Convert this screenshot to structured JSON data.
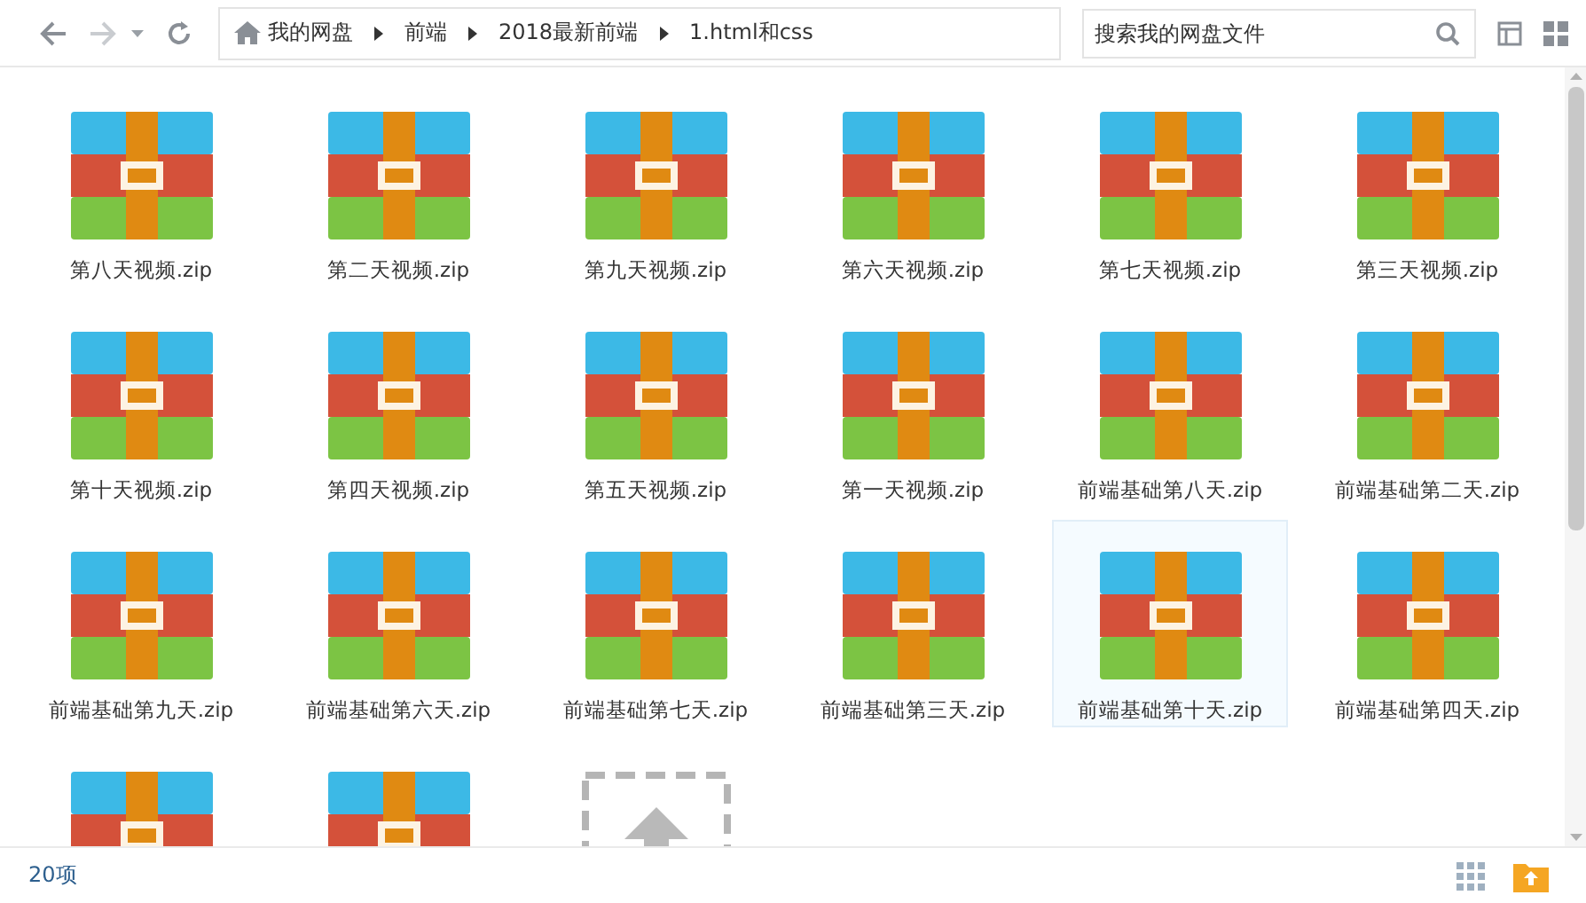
{
  "toolbar": {
    "breadcrumbs": [
      "我的网盘",
      "前端",
      "2018最新前端",
      "1.html和css"
    ],
    "search": {
      "placeholder": "搜索我的网盘文件"
    }
  },
  "files": [
    {
      "kind": "zip",
      "name": "第八天视频.zip",
      "hovered": false
    },
    {
      "kind": "zip",
      "name": "第二天视频.zip",
      "hovered": false
    },
    {
      "kind": "zip",
      "name": "第九天视频.zip",
      "hovered": false
    },
    {
      "kind": "zip",
      "name": "第六天视频.zip",
      "hovered": false
    },
    {
      "kind": "zip",
      "name": "第七天视频.zip",
      "hovered": false
    },
    {
      "kind": "zip",
      "name": "第三天视频.zip",
      "hovered": false
    },
    {
      "kind": "zip",
      "name": "第十天视频.zip",
      "hovered": false
    },
    {
      "kind": "zip",
      "name": "第四天视频.zip",
      "hovered": false
    },
    {
      "kind": "zip",
      "name": "第五天视频.zip",
      "hovered": false
    },
    {
      "kind": "zip",
      "name": "第一天视频.zip",
      "hovered": false
    },
    {
      "kind": "zip",
      "name": "前端基础第八天.zip",
      "hovered": false
    },
    {
      "kind": "zip",
      "name": "前端基础第二天.zip",
      "hovered": false
    },
    {
      "kind": "zip",
      "name": "前端基础第九天.zip",
      "hovered": false
    },
    {
      "kind": "zip",
      "name": "前端基础第六天.zip",
      "hovered": false
    },
    {
      "kind": "zip",
      "name": "前端基础第七天.zip",
      "hovered": false
    },
    {
      "kind": "zip",
      "name": "前端基础第三天.zip",
      "hovered": false
    },
    {
      "kind": "zip",
      "name": "前端基础第十天.zip",
      "hovered": true
    },
    {
      "kind": "zip",
      "name": "前端基础第四天.zip",
      "hovered": false
    },
    {
      "kind": "zip",
      "hovered": false
    },
    {
      "kind": "zip",
      "hovered": false
    },
    {
      "kind": "upload",
      "hovered": false
    }
  ],
  "status_bar": {
    "count": "20项"
  }
}
